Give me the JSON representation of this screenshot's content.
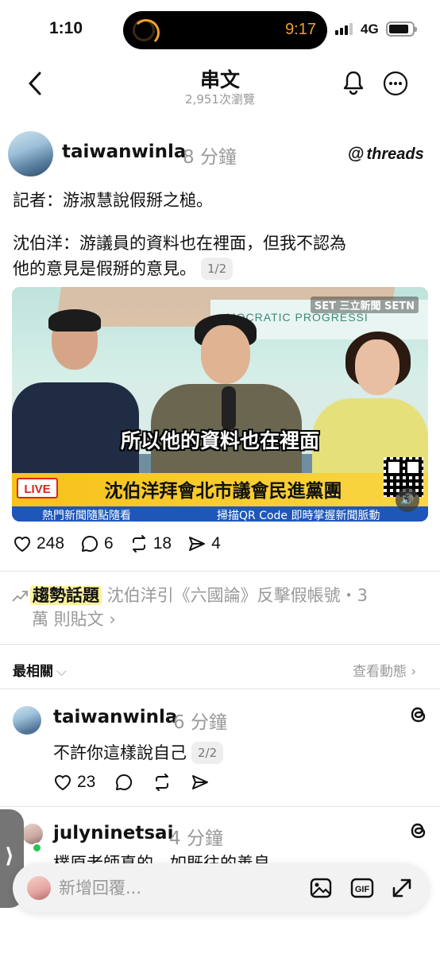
{
  "status": {
    "time": "1:10",
    "island_time": "9:17",
    "network": "4G"
  },
  "nav": {
    "title": "串文",
    "views": "2,951次瀏覽"
  },
  "post": {
    "username": "taiwanwinla",
    "time": "8 分鐘",
    "brand": "threads",
    "line1": "記者：游淑慧說假掰之槌。",
    "line2": "沈伯洋：游議員的資料也在裡面，但我不認為",
    "line3": "他的意見是假掰的意見。",
    "page_pill": "1/2",
    "media": {
      "caption": "所以他的資料也在裡面",
      "live": "LIVE",
      "headline": "沈伯洋拜會北市議會民進黨團",
      "ticker_left": "熱門新聞隨點隨看",
      "ticker_right": "掃描QR Code  即時掌握新聞脈動",
      "backdrop_text": "MOCRATIC PROGRESSI",
      "channel": "SET 三立新聞 SETN"
    },
    "likes": "248",
    "comments": "6",
    "reposts": "18",
    "shares": "4"
  },
  "trending": {
    "tag": "趨勢話題",
    "text_line1": " 沈伯洋引《六國論》反擊假帳號・3",
    "text_line2": "萬 則貼文 ›"
  },
  "sort": {
    "label": "最相關",
    "chevron": "⌵",
    "activity": "查看動態 ›"
  },
  "replies": [
    {
      "username": "taiwanwinla",
      "time": "6 分鐘",
      "text": "不許你這樣說自己",
      "page_pill": "2/2",
      "likes": "23"
    },
    {
      "username": "julyninetsai",
      "time": "4 分鐘",
      "text": "樸原老師真的，如既往的善良"
    }
  ],
  "side_tab": {
    "glyph": "⟩"
  },
  "composer": {
    "placeholder": "新增回覆..."
  },
  "colors": {
    "accent_highlight": "#fdf29a",
    "live_red": "#e2231a",
    "news_yellow": "#f7c21a",
    "ticker_blue": "#1f57b8",
    "online_green": "#23c552"
  }
}
